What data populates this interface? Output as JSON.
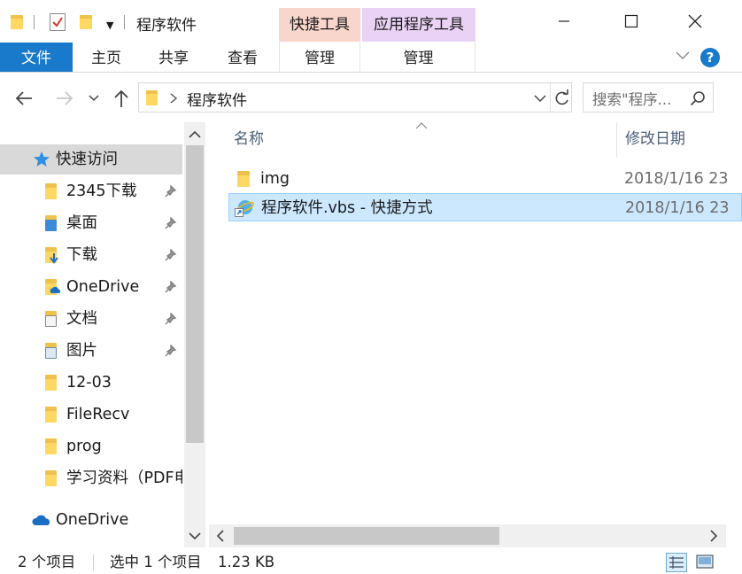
{
  "window": {
    "title": "程序软件",
    "context_tabs": [
      {
        "label": "快捷工具",
        "color": "#f9d6cb"
      },
      {
        "label": "应用程序工具",
        "color": "#ead2f5"
      }
    ]
  },
  "ribbon": {
    "tabs": [
      "文件",
      "主页",
      "共享",
      "查看",
      "管理",
      "管理"
    ],
    "accent": "#1979ca"
  },
  "address": {
    "path": "程序软件",
    "search_placeholder": "搜索\"程序..."
  },
  "nav": {
    "quick_access": "快速访问",
    "items": [
      {
        "label": "2345下载",
        "pinned": true
      },
      {
        "label": "桌面",
        "pinned": true
      },
      {
        "label": "下载",
        "pinned": true
      },
      {
        "label": "OneDrive",
        "pinned": true
      },
      {
        "label": "文档",
        "pinned": true
      },
      {
        "label": "图片",
        "pinned": true
      },
      {
        "label": "12-03",
        "pinned": false
      },
      {
        "label": "FileRecv",
        "pinned": false
      },
      {
        "label": "prog",
        "pinned": false
      },
      {
        "label": "学习资料（PDF电",
        "pinned": false
      }
    ],
    "onedrive": "OneDrive"
  },
  "content": {
    "columns": {
      "name": "名称",
      "date": "修改日期"
    },
    "files": [
      {
        "name": "img",
        "date": "2018/1/16 23",
        "type": "folder"
      },
      {
        "name": "程序软件.vbs - 快捷方式",
        "date": "2018/1/16 23",
        "type": "shortcut",
        "selected": true
      }
    ]
  },
  "status": {
    "count": "2 个项目",
    "selection": "选中 1 个项目",
    "size": "1.23 KB"
  }
}
